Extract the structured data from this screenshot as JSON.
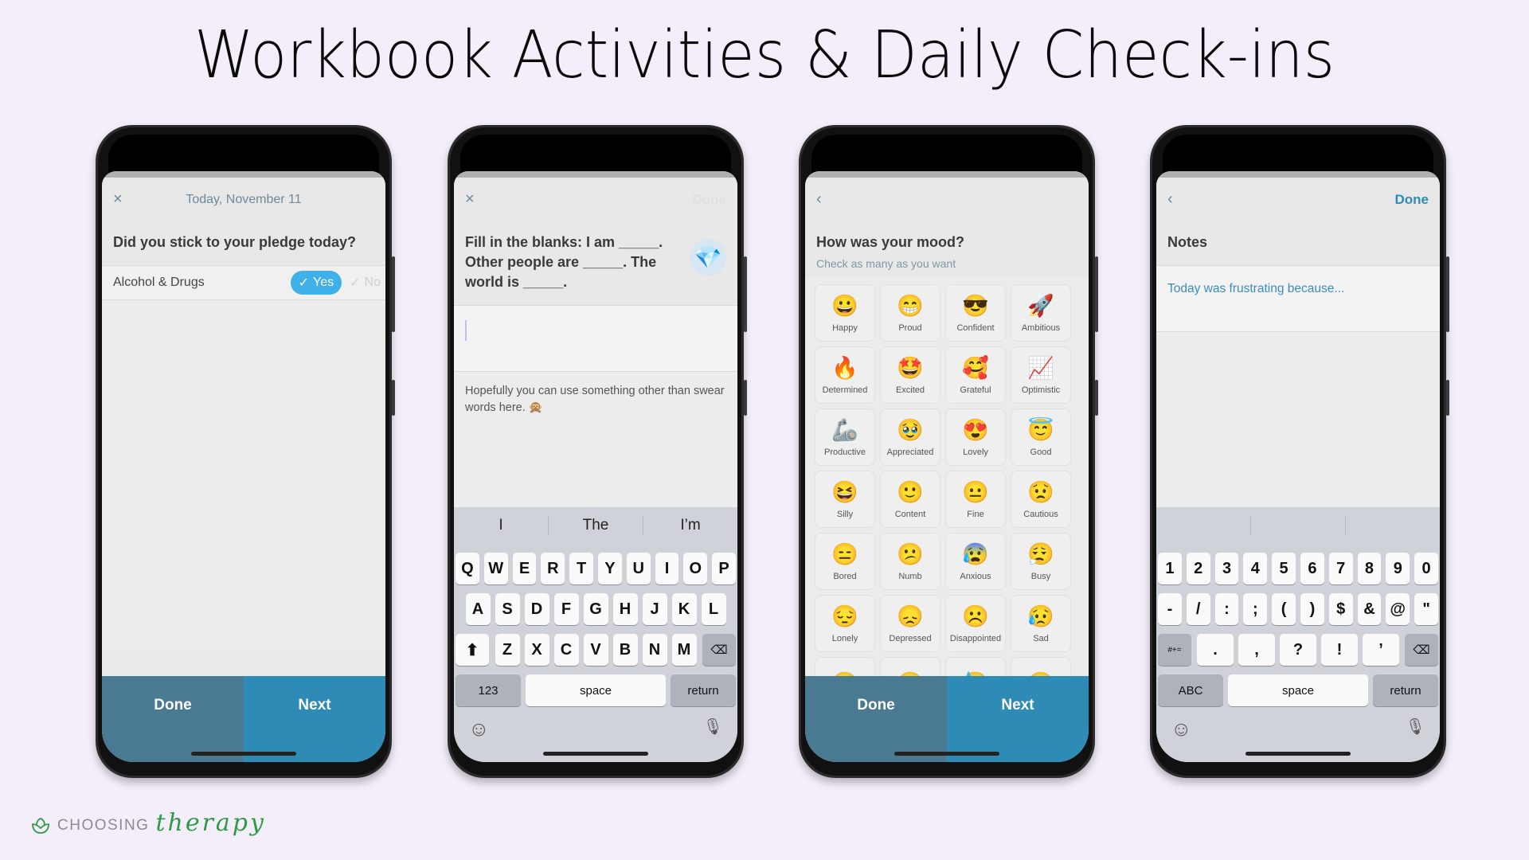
{
  "page": {
    "title": "Workbook Activities & Daily Check-ins",
    "brand": {
      "word1": "CHOOSING",
      "word2": "therapy",
      "icon": "lotus-leaf-icon",
      "accent": "#2e9a45"
    }
  },
  "colors": {
    "background": "#f4edfa",
    "primary_blue": "#2e8bb6",
    "done_blue": "#4a7a92",
    "yes_pill": "#3fb0e8"
  },
  "phone1": {
    "nav": {
      "close_icon": "×",
      "title": "Today, November 11"
    },
    "question": "Did you stick to your pledge today?",
    "pledge": {
      "label": "Alcohol & Drugs",
      "yes": "Yes",
      "no": "No",
      "check": "✓",
      "selected": "Yes"
    },
    "buttons": {
      "done": "Done",
      "next": "Next"
    }
  },
  "phone2": {
    "nav": {
      "close_icon": "×",
      "done": "Done"
    },
    "question": "Fill in the blanks: I am _____. Other people are _____. The world is _____.",
    "gem_icon": "💎",
    "answer_value": "",
    "hint": "Hopefully you can use something other than swear words here. 🙊",
    "keyboard": {
      "suggestions": [
        "I",
        "The",
        "I’m"
      ],
      "row1": [
        "Q",
        "W",
        "E",
        "R",
        "T",
        "Y",
        "U",
        "I",
        "O",
        "P"
      ],
      "row2": [
        "A",
        "S",
        "D",
        "F",
        "G",
        "H",
        "J",
        "K",
        "L"
      ],
      "row3": [
        "Z",
        "X",
        "C",
        "V",
        "B",
        "N",
        "M"
      ],
      "shift": "⬆",
      "backspace": "⌫",
      "mode": "123",
      "space": "space",
      "return": "return",
      "emoji": "☺",
      "mic": "🎙"
    }
  },
  "phone3": {
    "nav": {
      "back_icon": "‹"
    },
    "question": "How was your mood?",
    "subtitle": "Check as many as you want",
    "moods": [
      {
        "emoji": "😀",
        "label": "Happy"
      },
      {
        "emoji": "😁",
        "label": "Proud"
      },
      {
        "emoji": "😎",
        "label": "Confident"
      },
      {
        "emoji": "🚀",
        "label": "Ambitious"
      },
      {
        "emoji": "🔥",
        "label": "Determined"
      },
      {
        "emoji": "🤩",
        "label": "Excited"
      },
      {
        "emoji": "🥰",
        "label": "Grateful"
      },
      {
        "emoji": "📈",
        "label": "Optimistic"
      },
      {
        "emoji": "🦾",
        "label": "Productive"
      },
      {
        "emoji": "🥹",
        "label": "Appreciated"
      },
      {
        "emoji": "😍",
        "label": "Lovely"
      },
      {
        "emoji": "😇",
        "label": "Good"
      },
      {
        "emoji": "😆",
        "label": "Silly"
      },
      {
        "emoji": "🙂",
        "label": "Content"
      },
      {
        "emoji": "😐",
        "label": "Fine"
      },
      {
        "emoji": "😟",
        "label": "Cautious"
      },
      {
        "emoji": "😑",
        "label": "Bored"
      },
      {
        "emoji": "😕",
        "label": "Numb"
      },
      {
        "emoji": "😰",
        "label": "Anxious"
      },
      {
        "emoji": "😮‍💨",
        "label": "Busy"
      },
      {
        "emoji": "😔",
        "label": "Lonely"
      },
      {
        "emoji": "😞",
        "label": "Depressed"
      },
      {
        "emoji": "☹️",
        "label": "Disappointed"
      },
      {
        "emoji": "😥",
        "label": "Sad"
      },
      {
        "emoji": "😶",
        "label": ""
      },
      {
        "emoji": "😶",
        "label": ""
      },
      {
        "emoji": "😓",
        "label": ""
      },
      {
        "emoji": "😶",
        "label": ""
      }
    ],
    "buttons": {
      "done": "Done",
      "next": "Next"
    }
  },
  "phone4": {
    "nav": {
      "back_icon": "‹",
      "done": "Done"
    },
    "title": "Notes",
    "notes_value": "Today was frustrating because...",
    "keyboard": {
      "suggestions": [
        "",
        "",
        ""
      ],
      "row1": [
        "1",
        "2",
        "3",
        "4",
        "5",
        "6",
        "7",
        "8",
        "9",
        "0"
      ],
      "row2": [
        "-",
        "/",
        ":",
        ";",
        "(",
        ")",
        "$",
        "&",
        "@",
        "\""
      ],
      "row3": [
        ".",
        ",",
        "?",
        "!",
        "’"
      ],
      "symbols": "#+=",
      "backspace": "⌫",
      "mode": "ABC",
      "space": "space",
      "return": "return",
      "emoji": "☺",
      "mic": "🎙"
    }
  }
}
